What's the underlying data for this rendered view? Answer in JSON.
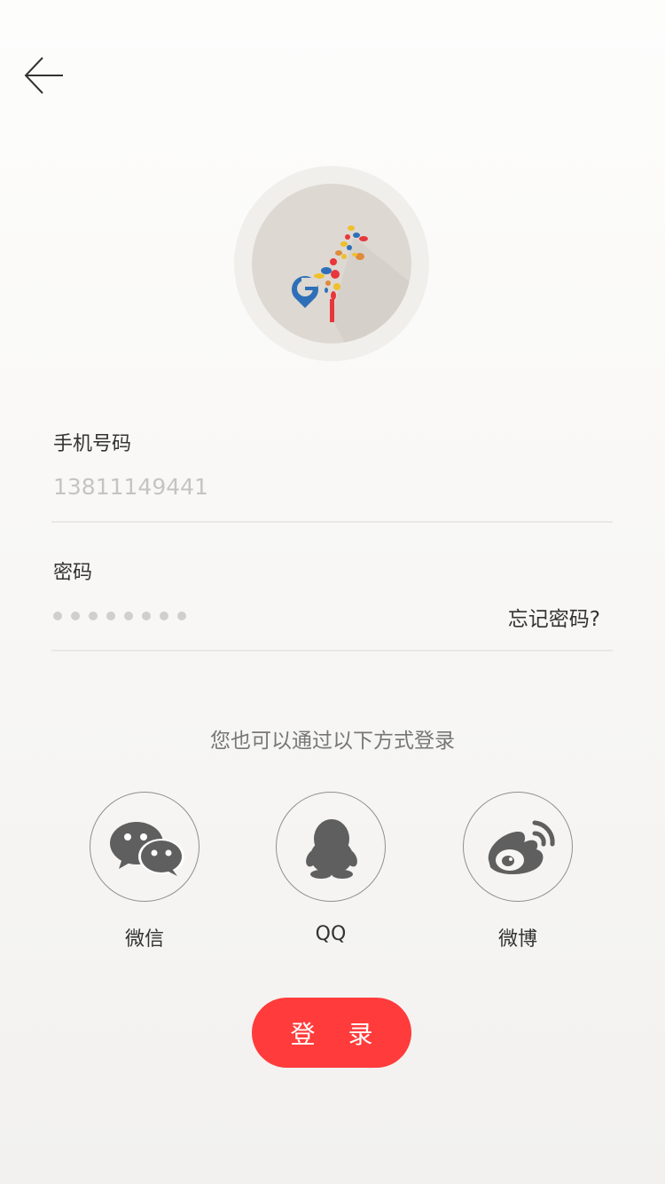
{
  "phone": {
    "label": "手机号码",
    "placeholder": "13811149441"
  },
  "password": {
    "label": "密码",
    "masked_length": 8,
    "forgot_label": "忘记密码?"
  },
  "alt_login_text": "您也可以通过以下方式登录",
  "social": [
    {
      "label": "微信",
      "icon": "wechat-icon"
    },
    {
      "label": "QQ",
      "icon": "qq-icon"
    },
    {
      "label": "微博",
      "icon": "weibo-icon"
    }
  ],
  "login_button": "登 录",
  "colors": {
    "accent": "#ff3b3b",
    "avatar_bg": "#ddd8d1",
    "icon_gray": "#5f5f5f"
  }
}
